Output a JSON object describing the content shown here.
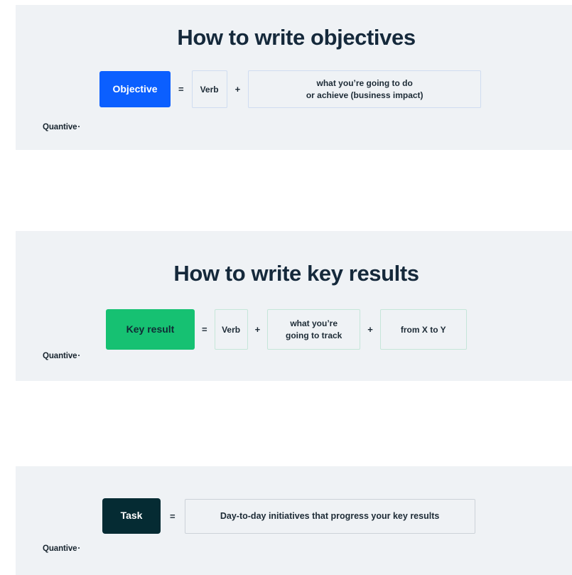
{
  "colors": {
    "page_background": "#ffffff",
    "panel_background": "#eff2f5",
    "heading_text": "#15293b",
    "objective_chip": "#0b5fff",
    "objective_chip_text": "#ffffff",
    "objective_box_border": "#cfdcf0",
    "keyresult_chip": "#16c172",
    "keyresult_chip_text": "#102b35",
    "keyresult_box_border": "#c5e6d9",
    "task_chip": "#052b33",
    "task_chip_text": "#ffffff",
    "task_box_border": "#ccd2d8",
    "body_text": "#1d2b36",
    "logo_text": "#17242e"
  },
  "brand": {
    "name": "Quantive",
    "mark": "registered-dot"
  },
  "panels": [
    {
      "id": "objectives",
      "heading": "How to write objectives",
      "formula": {
        "chip": "Objective",
        "operator_equals": "=",
        "operator_plus": "+",
        "verb_box": "Verb",
        "description_box_line1": "what you’re going to do",
        "description_box_line2": "or achieve (business impact)"
      },
      "logo": "Quantive"
    },
    {
      "id": "keyresults",
      "heading": "How to write key results",
      "formula": {
        "chip": "Key result",
        "operator_equals": "=",
        "operator_plus_1": "+",
        "operator_plus_2": "+",
        "verb_box": "Verb",
        "track_box_line1": "what you’re",
        "track_box_line2": "going to track",
        "range_box": "from X to Y"
      },
      "logo": "Quantive"
    },
    {
      "id": "tasks",
      "heading": "",
      "formula": {
        "chip": "Task",
        "operator_equals": "=",
        "description_box": "Day-to-day initiatives that progress your key results"
      },
      "logo": "Quantive"
    }
  ]
}
